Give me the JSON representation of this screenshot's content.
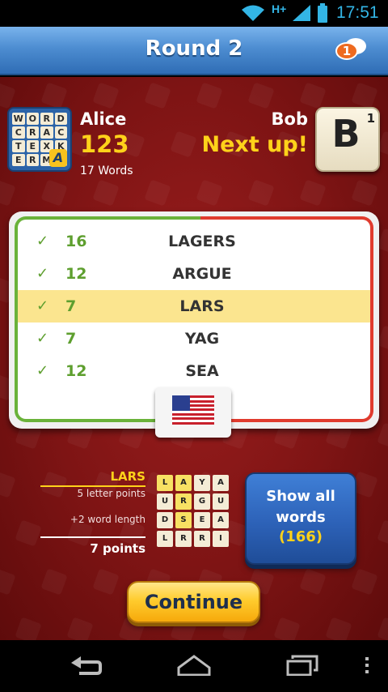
{
  "status_bar": {
    "network_type": "H+",
    "time": "17:51",
    "colors": {
      "icons": "#33b5e5"
    }
  },
  "header": {
    "title": "Round 2",
    "chat_badge_count": "1",
    "colors": {
      "bar": "#4d8dd1",
      "badge": "#ee6a1f"
    }
  },
  "players": {
    "left": {
      "name": "Alice",
      "score": "123",
      "words": "17 Words"
    },
    "right": {
      "name": "Bob",
      "status": "Next up!",
      "tile_letter": "B",
      "tile_points": "1"
    }
  },
  "game_logo": {
    "rows": [
      [
        "W",
        "O",
        "R",
        "D"
      ],
      [
        "C",
        "R",
        "A",
        "C"
      ],
      [
        "T",
        "E",
        "X",
        "K"
      ],
      [
        "E",
        "R",
        "M",
        "A"
      ]
    ]
  },
  "word_list": [
    {
      "points": "16",
      "word": "LAGERS",
      "highlighted": false
    },
    {
      "points": "12",
      "word": "ARGUE",
      "highlighted": false
    },
    {
      "points": "7",
      "word": "LARS",
      "highlighted": true
    },
    {
      "points": "7",
      "word": "YAG",
      "highlighted": false
    },
    {
      "points": "12",
      "word": "SEA",
      "highlighted": false
    }
  ],
  "dictionary_flag": "us-flag-icon",
  "breakdown": {
    "word": "LARS",
    "letter_points": "5 letter points",
    "length_bonus": "+2 word length",
    "total": "7 points"
  },
  "board": {
    "rows": [
      [
        "L",
        "A",
        "Y",
        "A"
      ],
      [
        "U",
        "R",
        "G",
        "U"
      ],
      [
        "D",
        "S",
        "E",
        "A"
      ],
      [
        "L",
        "R",
        "R",
        "I"
      ]
    ],
    "highlighted": [
      [
        0,
        0
      ],
      [
        0,
        1
      ],
      [
        1,
        1
      ],
      [
        2,
        1
      ]
    ]
  },
  "show_all_button": {
    "label_line1": "Show all",
    "label_line2": "words",
    "count": "(166)"
  },
  "continue_button": {
    "label": "Continue"
  },
  "colors": {
    "background": "#7a1212",
    "accent_yellow": "#ffd21a",
    "check_green": "#5e9f2f",
    "highlight_row": "#fbe58f"
  }
}
